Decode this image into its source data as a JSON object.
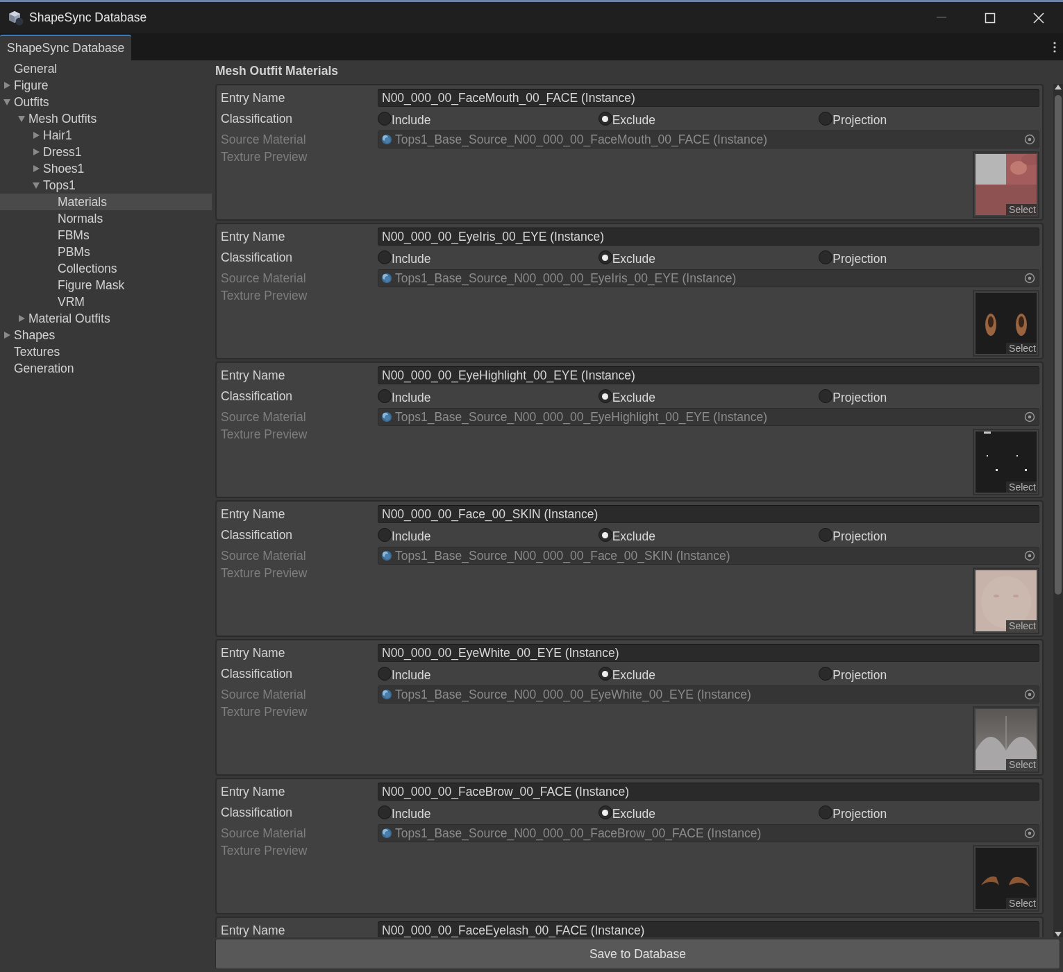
{
  "window": {
    "title": "ShapeSync Database"
  },
  "tabs": [
    {
      "label": "ShapeSync Database",
      "selected": true
    }
  ],
  "sidebar": {
    "items": [
      {
        "label": "General",
        "selected": false
      },
      {
        "label": "Figure",
        "selected": false,
        "expanded": false
      },
      {
        "label": "Outfits",
        "selected": false,
        "expanded": true,
        "children": [
          {
            "label": "Mesh Outfits",
            "selected": false,
            "expanded": true,
            "children": [
              {
                "label": "Hair1",
                "selected": false,
                "expanded": false
              },
              {
                "label": "Dress1",
                "selected": false,
                "expanded": false
              },
              {
                "label": "Shoes1",
                "selected": false,
                "expanded": false
              },
              {
                "label": "Tops1",
                "selected": false,
                "expanded": true,
                "children": [
                  {
                    "label": "Materials",
                    "selected": true
                  },
                  {
                    "label": "Normals",
                    "selected": false
                  },
                  {
                    "label": "FBMs",
                    "selected": false
                  },
                  {
                    "label": "PBMs",
                    "selected": false
                  },
                  {
                    "label": "Collections",
                    "selected": false
                  },
                  {
                    "label": "Figure Mask",
                    "selected": false
                  },
                  {
                    "label": "VRM",
                    "selected": false
                  }
                ]
              }
            ]
          },
          {
            "label": "Material Outfits",
            "selected": false,
            "expanded": false
          }
        ]
      },
      {
        "label": "Shapes",
        "selected": false,
        "expanded": false
      },
      {
        "label": "Textures",
        "selected": false
      },
      {
        "label": "Generation",
        "selected": false
      }
    ]
  },
  "section_title": "Mesh Outfit Materials",
  "entries": [
    {
      "entry_name_label": "Entry Name",
      "entry_name": "N00_000_00_FaceMouth_00_FACE (Instance)",
      "classification_label": "Classification",
      "classification": [
        {
          "label": "Include",
          "selected": false
        },
        {
          "label": "Exclude",
          "selected": true
        },
        {
          "label": "Projection",
          "selected": false
        }
      ],
      "source_material_label": "Source Material",
      "source_material": "Tops1_Base_Source_N00_000_00_FaceMouth_00_FACE (Instance)",
      "texture_preview_label": "Texture Preview",
      "select_label": "Select"
    },
    {
      "entry_name_label": "Entry Name",
      "entry_name": "N00_000_00_EyeIris_00_EYE (Instance)",
      "classification_label": "Classification",
      "classification": [
        {
          "label": "Include",
          "selected": false
        },
        {
          "label": "Exclude",
          "selected": true
        },
        {
          "label": "Projection",
          "selected": false
        }
      ],
      "source_material_label": "Source Material",
      "source_material": "Tops1_Base_Source_N00_000_00_EyeIris_00_EYE (Instance)",
      "texture_preview_label": "Texture Preview",
      "select_label": "Select"
    },
    {
      "entry_name_label": "Entry Name",
      "entry_name": "N00_000_00_EyeHighlight_00_EYE (Instance)",
      "classification_label": "Classification",
      "classification": [
        {
          "label": "Include",
          "selected": false
        },
        {
          "label": "Exclude",
          "selected": true
        },
        {
          "label": "Projection",
          "selected": false
        }
      ],
      "source_material_label": "Source Material",
      "source_material": "Tops1_Base_Source_N00_000_00_EyeHighlight_00_EYE (Instance)",
      "texture_preview_label": "Texture Preview",
      "select_label": "Select"
    },
    {
      "entry_name_label": "Entry Name",
      "entry_name": "N00_000_00_Face_00_SKIN (Instance)",
      "classification_label": "Classification",
      "classification": [
        {
          "label": "Include",
          "selected": false
        },
        {
          "label": "Exclude",
          "selected": true
        },
        {
          "label": "Projection",
          "selected": false
        }
      ],
      "source_material_label": "Source Material",
      "source_material": "Tops1_Base_Source_N00_000_00_Face_00_SKIN (Instance)",
      "texture_preview_label": "Texture Preview",
      "select_label": "Select"
    },
    {
      "entry_name_label": "Entry Name",
      "entry_name": "N00_000_00_EyeWhite_00_EYE (Instance)",
      "classification_label": "Classification",
      "classification": [
        {
          "label": "Include",
          "selected": false
        },
        {
          "label": "Exclude",
          "selected": true
        },
        {
          "label": "Projection",
          "selected": false
        }
      ],
      "source_material_label": "Source Material",
      "source_material": "Tops1_Base_Source_N00_000_00_EyeWhite_00_EYE (Instance)",
      "texture_preview_label": "Texture Preview",
      "select_label": "Select"
    },
    {
      "entry_name_label": "Entry Name",
      "entry_name": "N00_000_00_FaceBrow_00_FACE (Instance)",
      "classification_label": "Classification",
      "classification": [
        {
          "label": "Include",
          "selected": false
        },
        {
          "label": "Exclude",
          "selected": true
        },
        {
          "label": "Projection",
          "selected": false
        }
      ],
      "source_material_label": "Source Material",
      "source_material": "Tops1_Base_Source_N00_000_00_FaceBrow_00_FACE (Instance)",
      "texture_preview_label": "Texture Preview",
      "select_label": "Select"
    },
    {
      "entry_name_label": "Entry Name",
      "entry_name": "N00_000_00_FaceEyelash_00_FACE (Instance)"
    }
  ],
  "save_button": "Save to Database"
}
